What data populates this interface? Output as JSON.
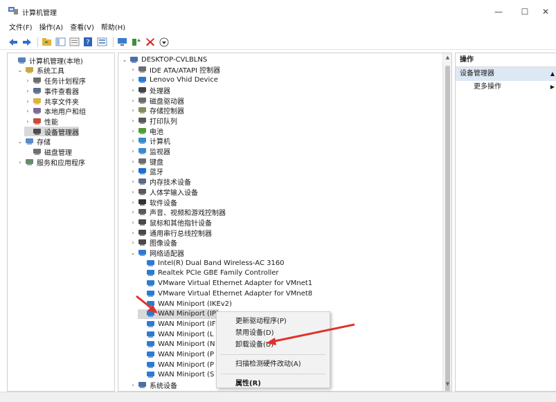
{
  "window": {
    "title": "计算机管理",
    "minimize": "—",
    "maximize": "☐",
    "close": "✕"
  },
  "menu": [
    "文件(F)",
    "操作(A)",
    "查看(V)",
    "帮助(H)"
  ],
  "left_tree": [
    {
      "label": "计算机管理(本地)",
      "indent": 0,
      "toggle": "",
      "icon": "computer-management-icon",
      "color": "#5a7fb8"
    },
    {
      "label": "系统工具",
      "indent": 1,
      "toggle": "⌄",
      "icon": "system-tools-icon",
      "color": "#c9a640"
    },
    {
      "label": "任务计划程序",
      "indent": 2,
      "toggle": "›",
      "icon": "task-scheduler-icon",
      "color": "#6d6d6d"
    },
    {
      "label": "事件查看器",
      "indent": 2,
      "toggle": "›",
      "icon": "event-viewer-icon",
      "color": "#5b6f8f"
    },
    {
      "label": "共享文件夹",
      "indent": 2,
      "toggle": "›",
      "icon": "shared-folders-icon",
      "color": "#d9b440"
    },
    {
      "label": "本地用户和组",
      "indent": 2,
      "toggle": "›",
      "icon": "local-users-icon",
      "color": "#7b6a9a"
    },
    {
      "label": "性能",
      "indent": 2,
      "toggle": "›",
      "icon": "performance-icon",
      "color": "#c84a3a"
    },
    {
      "label": "设备管理器",
      "indent": 2,
      "toggle": "",
      "icon": "device-manager-icon",
      "color": "#4d4d4d",
      "selected": true
    },
    {
      "label": "存储",
      "indent": 1,
      "toggle": "⌄",
      "icon": "storage-icon",
      "color": "#5a8ac8"
    },
    {
      "label": "磁盘管理",
      "indent": 2,
      "toggle": "",
      "icon": "disk-management-icon",
      "color": "#707070"
    },
    {
      "label": "服务和应用程序",
      "indent": 1,
      "toggle": "›",
      "icon": "services-icon",
      "color": "#6a8a6a"
    }
  ],
  "device_tree": [
    {
      "label": "DESKTOP-CVLBLNS",
      "indent": 0,
      "toggle": "⌄",
      "icon": "computer-icon",
      "color": "#4a6fa5"
    },
    {
      "label": "IDE ATA/ATAPI 控制器",
      "indent": 1,
      "toggle": "›",
      "icon": "ide-controller-icon",
      "color": "#6d6d6d"
    },
    {
      "label": "Lenovo Vhid Device",
      "indent": 1,
      "toggle": "›",
      "icon": "network-adapter-icon",
      "color": "#2d7bd1"
    },
    {
      "label": "处理器",
      "indent": 1,
      "toggle": "›",
      "icon": "processor-icon",
      "color": "#444444"
    },
    {
      "label": "磁盘驱动器",
      "indent": 1,
      "toggle": "›",
      "icon": "disk-drive-icon",
      "color": "#6d6d6d"
    },
    {
      "label": "存储控制器",
      "indent": 1,
      "toggle": "›",
      "icon": "storage-controller-icon",
      "color": "#8a8a5a"
    },
    {
      "label": "打印队列",
      "indent": 1,
      "toggle": "›",
      "icon": "printer-icon",
      "color": "#5a5a5a"
    },
    {
      "label": "电池",
      "indent": 1,
      "toggle": "›",
      "icon": "battery-icon",
      "color": "#4f9a3a"
    },
    {
      "label": "计算机",
      "indent": 1,
      "toggle": "›",
      "icon": "computer-icon",
      "color": "#3a8ad1"
    },
    {
      "label": "监视器",
      "indent": 1,
      "toggle": "›",
      "icon": "monitor-icon",
      "color": "#3a8ad1"
    },
    {
      "label": "键盘",
      "indent": 1,
      "toggle": "›",
      "icon": "keyboard-icon",
      "color": "#6d6d6d"
    },
    {
      "label": "蓝牙",
      "indent": 1,
      "toggle": "›",
      "icon": "bluetooth-icon",
      "color": "#1a6fd1"
    },
    {
      "label": "内存技术设备",
      "indent": 1,
      "toggle": "›",
      "icon": "memory-device-icon",
      "color": "#5a6a8a"
    },
    {
      "label": "人体学输入设备",
      "indent": 1,
      "toggle": "›",
      "icon": "hid-icon",
      "color": "#5a5a5a"
    },
    {
      "label": "软件设备",
      "indent": 1,
      "toggle": "›",
      "icon": "software-device-icon",
      "color": "#333333"
    },
    {
      "label": "声音、视频和游戏控制器",
      "indent": 1,
      "toggle": "›",
      "icon": "audio-icon",
      "color": "#5a5a5a"
    },
    {
      "label": "鼠标和其他指针设备",
      "indent": 1,
      "toggle": "›",
      "icon": "mouse-icon",
      "color": "#4a4a4a"
    },
    {
      "label": "通用串行总线控制器",
      "indent": 1,
      "toggle": "›",
      "icon": "usb-icon",
      "color": "#4a4a4a"
    },
    {
      "label": "图像设备",
      "indent": 1,
      "toggle": "›",
      "icon": "camera-icon",
      "color": "#4a4a4a"
    },
    {
      "label": "网络适配器",
      "indent": 1,
      "toggle": "⌄",
      "icon": "network-adapter-icon",
      "color": "#2d7bd1"
    },
    {
      "label": "Intel(R) Dual Band Wireless-AC 3160",
      "indent": 2,
      "toggle": "",
      "icon": "network-adapter-icon",
      "color": "#2d7bd1"
    },
    {
      "label": "Realtek PCIe GBE Family Controller",
      "indent": 2,
      "toggle": "",
      "icon": "network-adapter-icon",
      "color": "#2d7bd1"
    },
    {
      "label": "VMware Virtual Ethernet Adapter for VMnet1",
      "indent": 2,
      "toggle": "",
      "icon": "network-adapter-icon",
      "color": "#2d7bd1"
    },
    {
      "label": "VMware Virtual Ethernet Adapter for VMnet8",
      "indent": 2,
      "toggle": "",
      "icon": "network-adapter-icon",
      "color": "#2d7bd1"
    },
    {
      "label": "WAN Miniport (IKEv2)",
      "indent": 2,
      "toggle": "",
      "icon": "network-adapter-icon",
      "color": "#2d7bd1"
    },
    {
      "label": "WAN Miniport (IP)",
      "indent": 2,
      "toggle": "",
      "icon": "network-adapter-icon",
      "color": "#2d7bd1",
      "selected": true
    },
    {
      "label": "WAN Miniport (IF",
      "indent": 2,
      "toggle": "",
      "icon": "network-adapter-icon",
      "color": "#2d7bd1"
    },
    {
      "label": "WAN Miniport (L",
      "indent": 2,
      "toggle": "",
      "icon": "network-adapter-icon",
      "color": "#2d7bd1"
    },
    {
      "label": "WAN Miniport (N",
      "indent": 2,
      "toggle": "",
      "icon": "network-adapter-icon",
      "color": "#2d7bd1"
    },
    {
      "label": "WAN Miniport (P",
      "indent": 2,
      "toggle": "",
      "icon": "network-adapter-icon",
      "color": "#2d7bd1"
    },
    {
      "label": "WAN Miniport (P",
      "indent": 2,
      "toggle": "",
      "icon": "network-adapter-icon",
      "color": "#2d7bd1"
    },
    {
      "label": "WAN Miniport (S",
      "indent": 2,
      "toggle": "",
      "icon": "network-adapter-icon",
      "color": "#2d7bd1"
    },
    {
      "label": "系统设备",
      "indent": 1,
      "toggle": "›",
      "icon": "system-device-icon",
      "color": "#4a6fa5"
    }
  ],
  "actions": {
    "header": "操作",
    "section": "设备管理器",
    "more": "更多操作"
  },
  "context_menu": {
    "update_driver": "更新驱动程序(P)",
    "disable": "禁用设备(D)",
    "uninstall": "卸载设备(U)",
    "scan": "扫描检测硬件改动(A)",
    "properties": "属性(R)"
  },
  "annotation_color": "#e0312b"
}
